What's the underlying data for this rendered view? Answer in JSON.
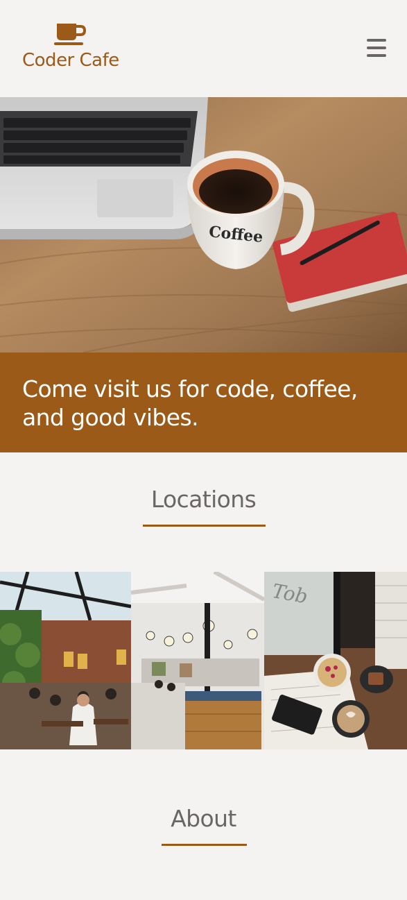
{
  "theme": {
    "accent": "#9c5a19",
    "text_muted": "#6b6663",
    "background": "#f4f3f1"
  },
  "header": {
    "brand_name": "Coder Cafe",
    "logo_icon": "coffee-cup-icon",
    "menu_icon": "hamburger-menu-icon"
  },
  "hero": {
    "image": "laptop-and-coffee-mug-photo",
    "mug_text": "Coffee"
  },
  "tagline": {
    "text": "Come visit us for code, coffee, and good vibes."
  },
  "locations": {
    "title": "Locations",
    "photos": [
      {
        "name": "cafe-interior-skylight-photo"
      },
      {
        "name": "cafe-counter-interior-photo"
      },
      {
        "name": "coffee-table-breakfast-photo"
      }
    ]
  },
  "about": {
    "title": "About"
  }
}
